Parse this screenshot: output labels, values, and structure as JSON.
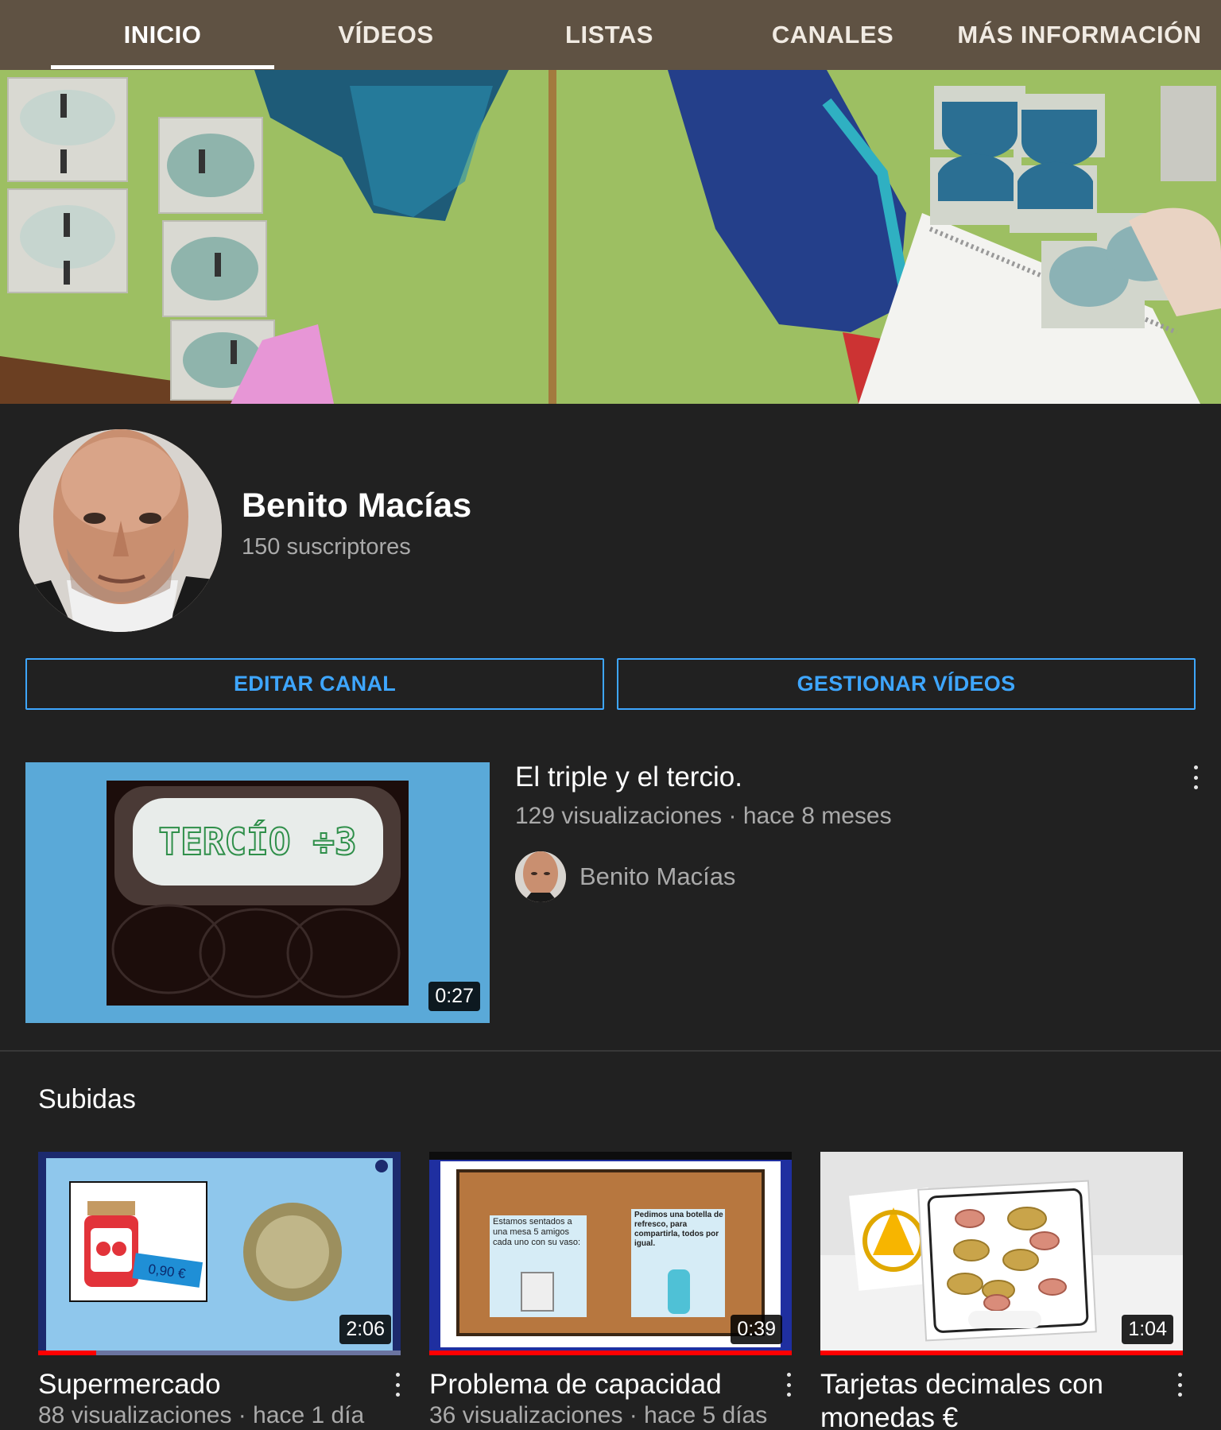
{
  "tabs": [
    {
      "label": "INICIO",
      "active": true
    },
    {
      "label": "VÍDEOS",
      "active": false
    },
    {
      "label": "LISTAS",
      "active": false
    },
    {
      "label": "CANALES",
      "active": false
    },
    {
      "label": "MÁS INFORMACIÓN",
      "active": false
    }
  ],
  "channel": {
    "name": "Benito Macías",
    "subscribers": "150 suscriptores"
  },
  "actions": {
    "edit": "EDITAR CANAL",
    "manage": "GESTIONAR VÍDEOS"
  },
  "featured": {
    "title": "El triple y el tercio.",
    "meta": "129 visualizaciones · hace 8 meses",
    "author": "Benito Macías",
    "duration": "0:27",
    "thumb_text": "TERCÍO ÷3"
  },
  "uploads": {
    "title": "Subidas",
    "videos": [
      {
        "title": "Supermercado",
        "meta": "88 visualizaciones · hace 1 día",
        "duration": "2:06",
        "watched": 0.16,
        "price_tag": "0,90 €"
      },
      {
        "title": "Problema de capacidad",
        "meta": "36 visualizaciones · hace 5 días",
        "duration": "0:39",
        "watched": 1.0,
        "note_left": "Estamos sentados a una mesa 5 amigos cada uno con su vaso:",
        "note_right": "Pedimos una botella de refresco, para compartirla, todos por igual."
      },
      {
        "title": "Tarjetas decimales con monedas €",
        "meta": "",
        "duration": "1:04",
        "watched": 1.0
      }
    ]
  },
  "colors": {
    "tabbar": "#5f5243",
    "background": "#212121",
    "accent": "#3ea6ff",
    "progress": "#ff0000"
  }
}
